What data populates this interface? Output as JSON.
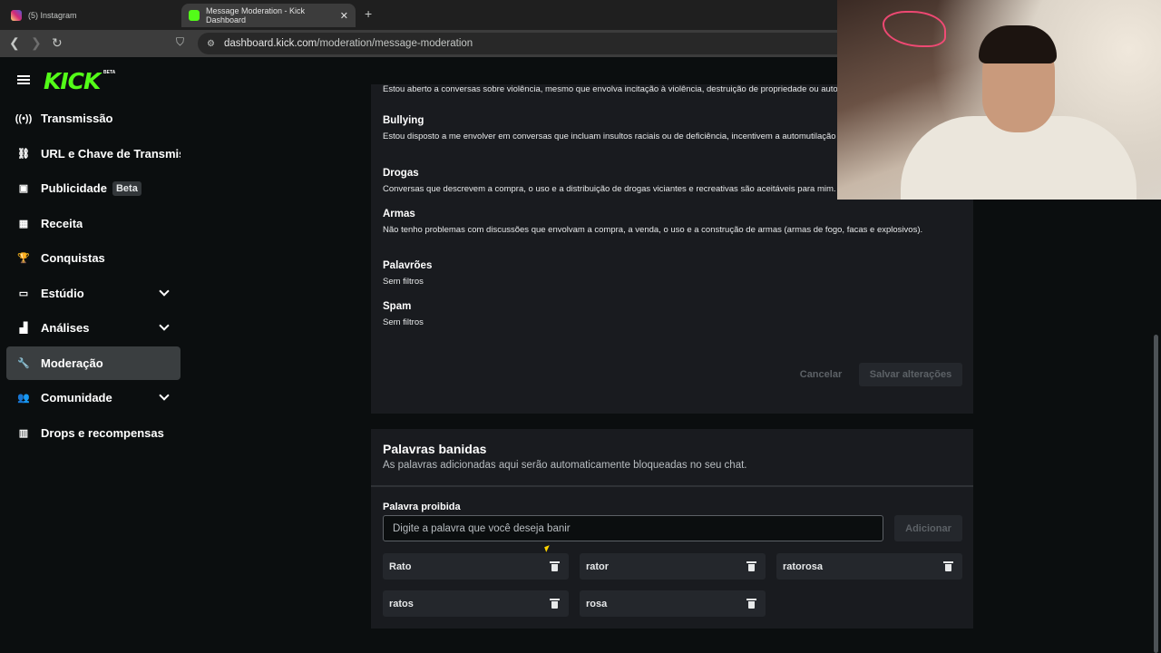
{
  "browser": {
    "tabs": [
      {
        "title": "(5) Instagram",
        "favicon_color": "#d62976"
      },
      {
        "title": "Message Moderation - Kick Dashboard",
        "favicon_color": "#53fc18"
      }
    ],
    "close_glyph": "✕",
    "new_tab_glyph": "+",
    "url_host": "dashboard.kick.com",
    "url_path": "/moderation/message-moderation"
  },
  "brand": {
    "logo_text": "KICK",
    "logo_badge": "BETA",
    "accent": "#53fc18"
  },
  "sidebar": {
    "items": [
      {
        "label": "Transmissão",
        "icon": "broadcast-icon",
        "glyph": "((•))"
      },
      {
        "label": "URL e Chave de Transmissão",
        "icon": "link-icon",
        "glyph": "⛓"
      },
      {
        "label": "Publicidade",
        "icon": "ad-icon",
        "glyph": "▣",
        "badge": "Beta"
      },
      {
        "label": "Receita",
        "icon": "wallet-icon",
        "glyph": "▦"
      },
      {
        "label": "Conquistas",
        "icon": "trophy-icon",
        "glyph": "🏆"
      },
      {
        "label": "Estúdio",
        "icon": "studio-icon",
        "glyph": "▭",
        "expandable": true
      },
      {
        "label": "Análises",
        "icon": "chart-icon",
        "glyph": "▟",
        "expandable": true
      },
      {
        "label": "Moderação",
        "icon": "wrench-icon",
        "glyph": "🔧",
        "active": true
      },
      {
        "label": "Comunidade",
        "icon": "people-icon",
        "glyph": "👥",
        "expandable": true
      },
      {
        "label": "Drops e recompensas",
        "icon": "gift-icon",
        "glyph": "▥"
      }
    ]
  },
  "filters": {
    "categories": [
      {
        "title": "",
        "description": "Estou aberto a conversas sobre violência, mesmo que envolva incitação à violência, destruição de propriedade ou automutilação."
      },
      {
        "title": "Bullying",
        "description": "Estou disposto a me envolver em conversas que incluam insultos raciais ou de deficiência, incentivem a automutilação ou sejam violentas."
      },
      {
        "title": "Drogas",
        "description": "Conversas que descrevem a compra, o uso e a distribuição de drogas viciantes e recreativas são aceitáveis para mim."
      },
      {
        "title": "Armas",
        "description": "Não tenho problemas com discussões que envolvam a compra, a venda, o uso e a construção de armas (armas de fogo, facas e explosivos)."
      },
      {
        "title": "Palavrões",
        "description": "Sem filtros"
      },
      {
        "title": "Spam",
        "description": "Sem filtros"
      }
    ],
    "cancel_label": "Cancelar",
    "save_label": "Salvar alterações"
  },
  "banned_words": {
    "title": "Palavras banidas",
    "subtitle": "As palavras adicionadas aqui serão automaticamente bloqueadas no seu chat.",
    "field_label": "Palavra proibida",
    "input_placeholder": "Digite a palavra que você deseja banir",
    "add_label": "Adicionar",
    "words": [
      "Rato",
      "rator",
      "ratorosa",
      "ratos",
      "rosa"
    ]
  }
}
